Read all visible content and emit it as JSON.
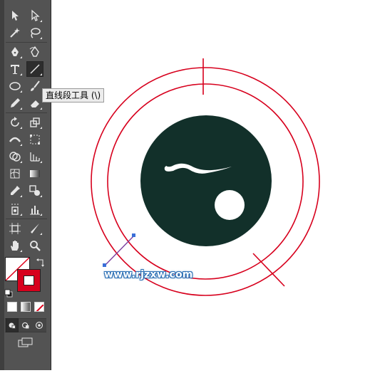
{
  "toolbar": {
    "tools": [
      {
        "name": "selection-tool-icon"
      },
      {
        "name": "direct-selection-tool-icon"
      },
      {
        "name": "magic-wand-tool-icon"
      },
      {
        "name": "lasso-tool-icon"
      },
      {
        "name": "pen-tool-icon"
      },
      {
        "name": "curvature-tool-icon"
      },
      {
        "name": "type-tool-icon"
      },
      {
        "name": "line-segment-tool-icon",
        "active": true
      },
      {
        "name": "ellipse-tool-icon"
      },
      {
        "name": "paintbrush-tool-icon"
      },
      {
        "name": "pencil-tool-icon"
      },
      {
        "name": "eraser-tool-icon"
      },
      {
        "name": "rotate-tool-icon"
      },
      {
        "name": "scale-tool-icon"
      },
      {
        "name": "width-tool-icon"
      },
      {
        "name": "free-transform-tool-icon"
      },
      {
        "name": "shape-builder-tool-icon"
      },
      {
        "name": "perspective-grid-tool-icon"
      },
      {
        "name": "mesh-tool-icon"
      },
      {
        "name": "gradient-tool-icon"
      },
      {
        "name": "eyedropper-tool-icon"
      },
      {
        "name": "blend-tool-icon"
      },
      {
        "name": "symbol-sprayer-tool-icon"
      },
      {
        "name": "column-graph-tool-icon"
      },
      {
        "name": "artboard-tool-icon"
      },
      {
        "name": "slice-tool-icon"
      },
      {
        "name": "hand-tool-icon"
      },
      {
        "name": "zoom-tool-icon"
      }
    ],
    "fill_color": "#ffffff",
    "stroke_color": "#d7001d"
  },
  "tooltip": {
    "text": "直线段工具 (\\)"
  },
  "artwork": {
    "circle_fill": "#12302a",
    "ring_color": "#d7001d",
    "guide_color": "#7b3fa0",
    "anchor_color": "#3a6fd8"
  },
  "watermark": {
    "text": "www.rjzxw.com"
  }
}
